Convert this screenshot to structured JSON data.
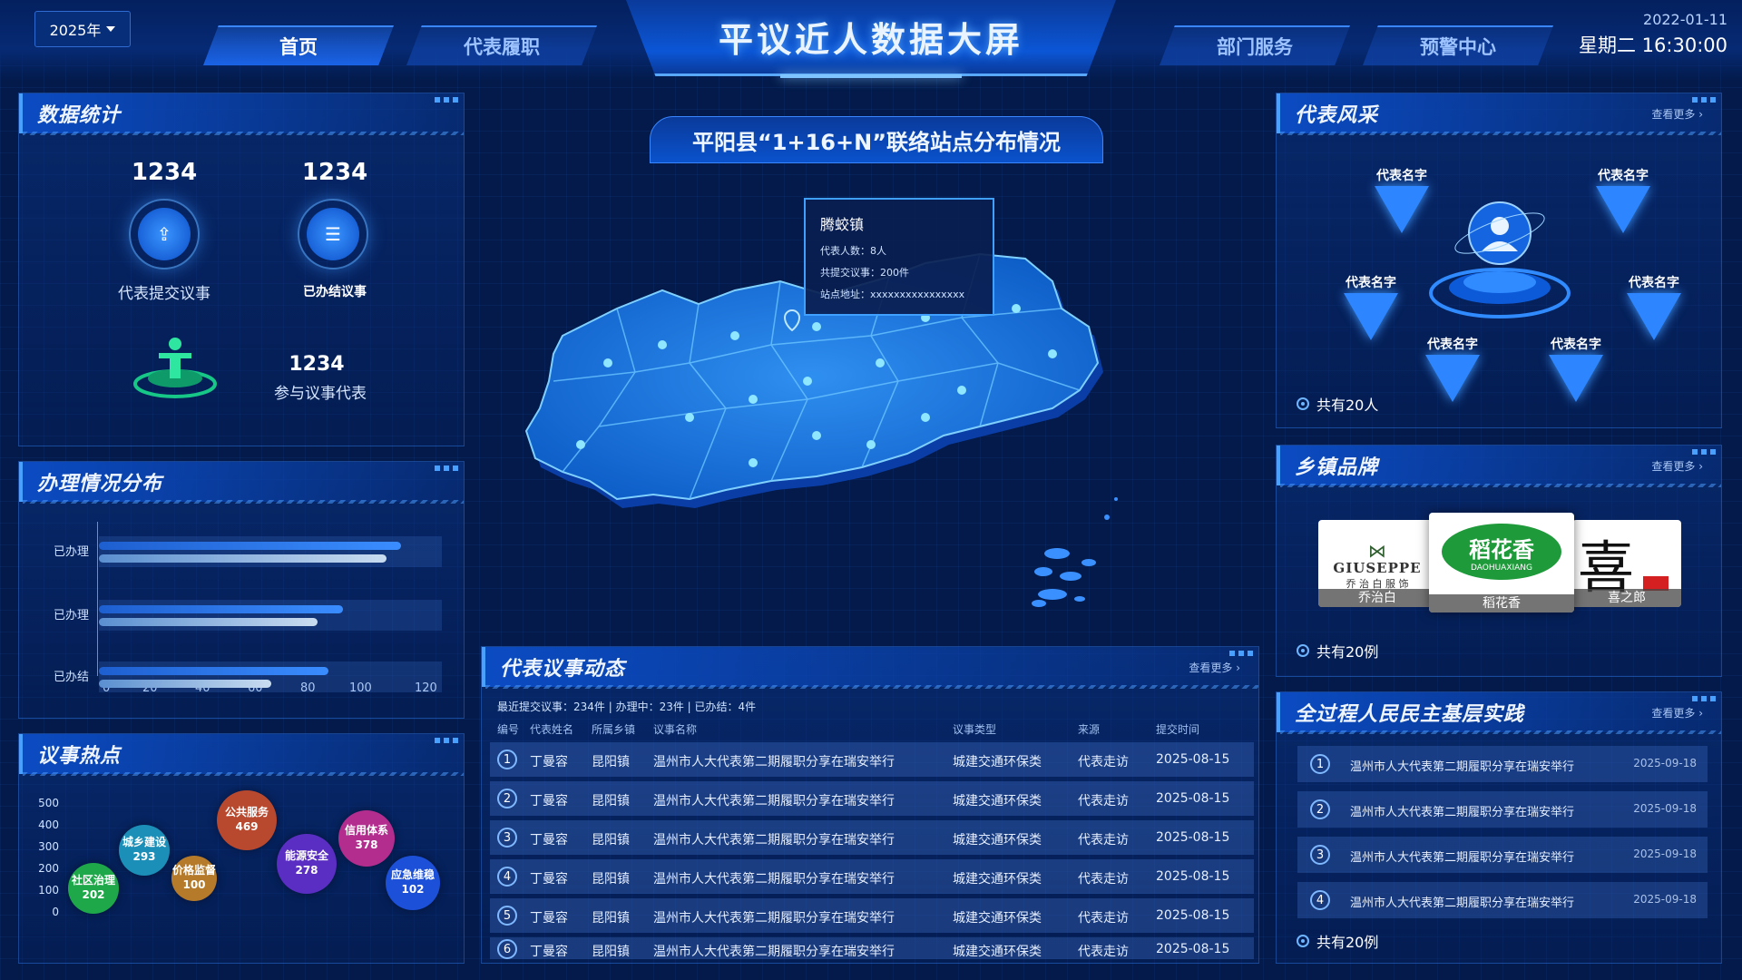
{
  "header": {
    "year": "2025年",
    "title": "平议近人数据大屏",
    "nav": [
      "首页",
      "代表履职",
      "部门服务",
      "预警中心"
    ],
    "date": "2022-01-11",
    "time": "星期二 16:30:00"
  },
  "stats": {
    "title": "数据统计",
    "items": [
      {
        "value": "1234",
        "label": "代表提交议事",
        "icon": "upload-icon"
      },
      {
        "value": "1234",
        "label": "已办结议事",
        "icon": "list-icon"
      },
      {
        "value": "1234",
        "label": "参与议事代表",
        "icon": "person-platform-icon"
      }
    ]
  },
  "handling": {
    "title": "办理情况分布",
    "chart_data": {
      "type": "bar",
      "categories": [
        "已办理",
        "已办理",
        "已办结"
      ],
      "series": [
        {
          "values": [
            105,
            85,
            80
          ]
        },
        {
          "values": [
            100,
            76,
            60
          ]
        }
      ],
      "xlim": [
        0,
        120
      ],
      "xticks": [
        "0",
        "20",
        "40",
        "60",
        "80",
        "100",
        "120"
      ]
    }
  },
  "hotspots": {
    "title": "议事热点",
    "yticks": [
      "500",
      "400",
      "300",
      "200",
      "100",
      "0"
    ],
    "bubbles": [
      {
        "name": "社区治理",
        "value": "202",
        "color": "#1fa84a"
      },
      {
        "name": "城乡建设",
        "value": "293",
        "color": "#1c8fb8"
      },
      {
        "name": "价格监督",
        "value": "100",
        "color": "#b57a2a"
      },
      {
        "name": "公共服务",
        "value": "469",
        "color": "#b8482e"
      },
      {
        "name": "能源安全",
        "value": "278",
        "color": "#5a2ec2"
      },
      {
        "name": "信用体系",
        "value": "378",
        "color": "#b32d8e"
      },
      {
        "name": "应急维稳",
        "value": "102",
        "color": "#1c50d8"
      }
    ]
  },
  "map": {
    "title": "平阳县“1+16+N”联络站点分布情况",
    "tooltip": {
      "name": "腾蛟镇",
      "reps": "代表人数：8人",
      "issues": "共提交议事：200件",
      "address": "站点地址：xxxxxxxxxxxxxxxx"
    }
  },
  "dynamics": {
    "title": "代表议事动态",
    "more": "查看更多 ›",
    "summary": "最近提交议事：234件 | 办理中：23件 | 已办结：4件",
    "columns": [
      "编号",
      "代表姓名",
      "所属乡镇",
      "议事名称",
      "议事类型",
      "来源",
      "提交时间"
    ],
    "rows": [
      [
        "1",
        "丁曼容",
        "昆阳镇",
        "温州市人大代表第二期履职分享在瑞安举行",
        "城建交通环保类",
        "代表走访",
        "2025-08-15"
      ],
      [
        "2",
        "丁曼容",
        "昆阳镇",
        "温州市人大代表第二期履职分享在瑞安举行",
        "城建交通环保类",
        "代表走访",
        "2025-08-15"
      ],
      [
        "3",
        "丁曼容",
        "昆阳镇",
        "温州市人大代表第二期履职分享在瑞安举行",
        "城建交通环保类",
        "代表走访",
        "2025-08-15"
      ],
      [
        "4",
        "丁曼容",
        "昆阳镇",
        "温州市人大代表第二期履职分享在瑞安举行",
        "城建交通环保类",
        "代表走访",
        "2025-08-15"
      ],
      [
        "5",
        "丁曼容",
        "昆阳镇",
        "温州市人大代表第二期履职分享在瑞安举行",
        "城建交通环保类",
        "代表走访",
        "2025-08-15"
      ],
      [
        "6",
        "丁曼容",
        "昆阳镇",
        "温州市人大代表第二期履职分享在瑞安举行",
        "城建交通环保类",
        "代表走访",
        "2025-08-15"
      ]
    ]
  },
  "reps": {
    "title": "代表风采",
    "more": "查看更多 ›",
    "names": [
      "代表名字",
      "代表名字",
      "代表名字",
      "代表名字",
      "代表名字",
      "代表名字"
    ],
    "total": "共有20人"
  },
  "brands": {
    "title": "乡镇品牌",
    "more": "查看更多 ›",
    "items": [
      {
        "caption": "乔治白",
        "logo": "GIUSEPPE",
        "sub": "乔 治 白 服 饰"
      },
      {
        "caption": "稻花香",
        "logo": "稻花香",
        "sub": "DAOHUAXIANG"
      },
      {
        "caption": "喜之郎",
        "logo": "喜"
      }
    ],
    "total": "共有20例"
  },
  "practice": {
    "title": "全过程人民民主基层实践",
    "more": "查看更多 ›",
    "items": [
      {
        "no": "1",
        "text": "温州市人大代表第二期履职分享在瑞安举行",
        "date": "2025-09-18"
      },
      {
        "no": "2",
        "text": "温州市人大代表第二期履职分享在瑞安举行",
        "date": "2025-09-18"
      },
      {
        "no": "3",
        "text": "温州市人大代表第二期履职分享在瑞安举行",
        "date": "2025-09-18"
      },
      {
        "no": "4",
        "text": "温州市人大代表第二期履职分享在瑞安举行",
        "date": "2025-09-18"
      }
    ],
    "total": "共有20例"
  },
  "colors": {
    "accent": "#3a86ff",
    "bg": "#031a4a",
    "bar1": "#3a8dff",
    "bar2": "#c9dcf0"
  }
}
